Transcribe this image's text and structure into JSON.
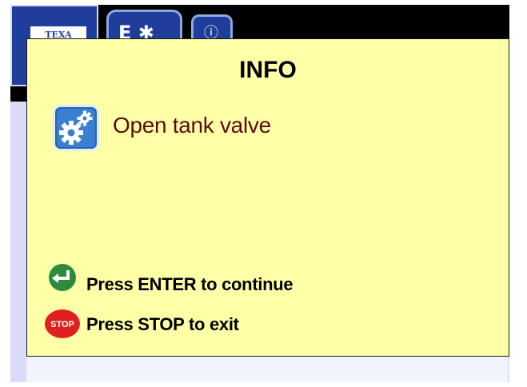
{
  "background": {
    "logo_text": "TEXA",
    "colors": {
      "header_bar": "#000000",
      "tab_fill": "#1f3d9a",
      "content_area": "#d8dcf6"
    }
  },
  "dialog": {
    "title": "INFO",
    "message": "Open tank valve",
    "message_icon": "gears-icon",
    "colors": {
      "background": "#ffffa8",
      "message_text": "#5a0d0d"
    },
    "hints": {
      "enter": {
        "icon": "enter-icon",
        "label": "Press ENTER to continue",
        "color": "#2e8b3e"
      },
      "stop": {
        "icon": "stop-icon",
        "icon_text": "STOP",
        "label": "Press STOP to exit",
        "color": "#e02020"
      }
    }
  }
}
